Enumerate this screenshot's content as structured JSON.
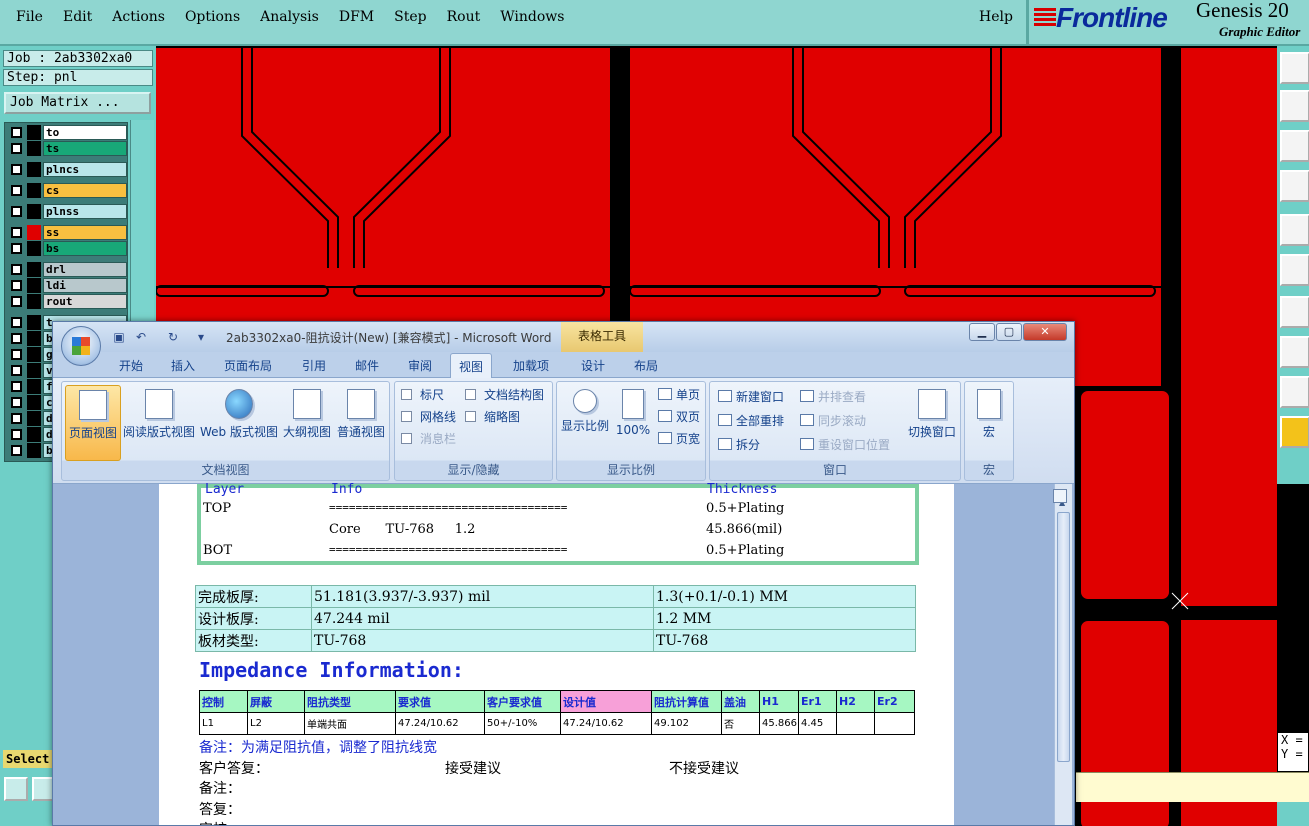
{
  "genesis": {
    "menu": [
      "File",
      "Edit",
      "Actions",
      "Options",
      "Analysis",
      "DFM",
      "Step",
      "Rout",
      "Windows"
    ],
    "help": "Help",
    "brand": "Frontline",
    "product": "Genesis 20",
    "product_sub": "Graphic Editor",
    "job": "Job : 2ab3302xa0",
    "step": "Step: pnl",
    "job_matrix_button": "Job Matrix ...",
    "select_label": "Select",
    "layers": [
      {
        "name": "to",
        "color": "#ffffff"
      },
      {
        "name": "ts",
        "color": "#18a878"
      },
      {
        "name": "plncs",
        "color": "#b8e6ea"
      },
      {
        "name": "cs",
        "color": "#f8c040"
      },
      {
        "name": "plnss",
        "color": "#b8e6ea"
      },
      {
        "name": "ss",
        "color": "#f8c040"
      },
      {
        "name": "bs",
        "color": "#18a878"
      },
      {
        "name": "drl",
        "color": "#b8c8cc"
      },
      {
        "name": "ldi",
        "color": "#b8c8cc"
      },
      {
        "name": "rout",
        "color": "#d8d8d8"
      },
      {
        "name": "t",
        "color": "#b8e6ea"
      },
      {
        "name": "b",
        "color": "#b8e6ea"
      },
      {
        "name": "g",
        "color": "#b8e6ea"
      },
      {
        "name": "v",
        "color": "#b8e6ea"
      },
      {
        "name": "f",
        "color": "#b8e6ea"
      },
      {
        "name": "c",
        "color": "#b8e6ea"
      },
      {
        "name": "d",
        "color": "#b8e6ea"
      },
      {
        "name": "d",
        "color": "#b8e6ea"
      },
      {
        "name": "b",
        "color": "#b8e6ea"
      }
    ],
    "coords": {
      "x": "X =",
      "y": "Y ="
    }
  },
  "word": {
    "title": "2ab3302xa0-阻抗设计(New) [兼容模式] - Microsoft Word",
    "context_tab": "表格工具",
    "tabs": [
      "开始",
      "插入",
      "页面布局",
      "引用",
      "邮件",
      "审阅",
      "视图",
      "加载项",
      "设计",
      "布局"
    ],
    "active_tab": "视图",
    "ribbon": {
      "doc_views": {
        "label": "文档视图",
        "buttons": [
          "页面视图",
          "阅读版式视图",
          "Web 版式视图",
          "大纲视图",
          "普通视图"
        ]
      },
      "show_hide": {
        "label": "显示/隐藏",
        "items": [
          "标尺",
          "网格线",
          "消息栏",
          "文档结构图",
          "缩略图"
        ]
      },
      "zoom": {
        "label": "显示比例",
        "buttons": [
          "显示比例",
          "100%"
        ],
        "small": [
          "单页",
          "双页",
          "页宽"
        ]
      },
      "window": {
        "label": "窗口",
        "items": [
          "新建窗口",
          "全部重排",
          "拆分",
          "并排查看",
          "同步滚动",
          "重设窗口位置"
        ],
        "switch": "切换窗口"
      },
      "macro": {
        "label": "宏",
        "button": "宏"
      }
    }
  },
  "document": {
    "stackup_headers": [
      "Layer",
      "Info",
      "Thickness"
    ],
    "stackup_rows": [
      {
        "layer": "TOP",
        "info": "====================================",
        "thickness": "0.5+Plating"
      },
      {
        "layer": "",
        "info": "Core      TU-768     1.2",
        "thickness": "45.866(mil)"
      },
      {
        "layer": "BOT",
        "info": "====================================",
        "thickness": "0.5+Plating"
      }
    ],
    "info_rows": [
      [
        "完成板厚:",
        "51.181(3.937/-3.937) mil",
        "1.3(+0.1/-0.1) MM"
      ],
      [
        "设计板厚:",
        "47.244 mil",
        "1.2 MM"
      ],
      [
        "板材类型:",
        "TU-768",
        "TU-768"
      ]
    ],
    "impedance_title": "Impedance Information:",
    "impedance_headers": [
      "控制",
      "屏蔽",
      "阻抗类型",
      "要求值",
      "客户要求值",
      "设计值",
      "阻抗计算值",
      "盖油",
      "H1",
      "Er1",
      "H2",
      "Er2"
    ],
    "impedance_rows": [
      [
        "L1",
        "L2",
        "单端共面",
        "47.24/10.62",
        "50+/-10%",
        "47.24/10.62",
        "49.102",
        "否",
        "45.866",
        "4.45",
        "",
        ""
      ]
    ],
    "note1": "备注：为满足阻抗值，调整了阻抗线宽",
    "customer_reply": "客户答复：",
    "accept": "接受建议",
    "reject": "不接受建议",
    "remark": "备注：",
    "answer": "答复：",
    "review": "审核"
  }
}
